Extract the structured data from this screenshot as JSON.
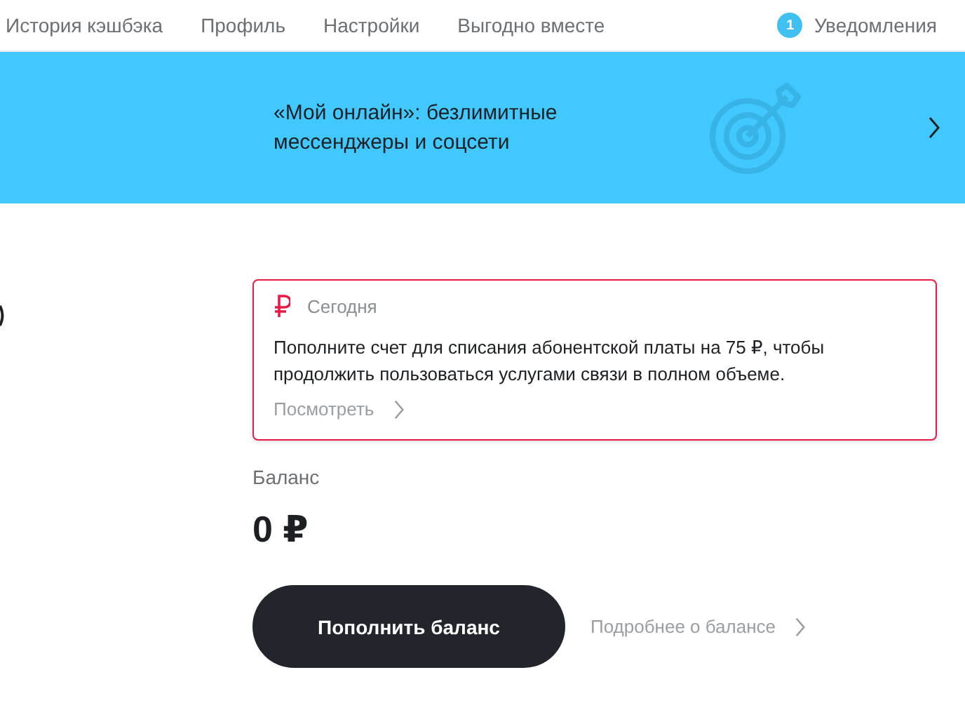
{
  "nav": {
    "items": [
      {
        "label": "История кэшбэка"
      },
      {
        "label": "Профиль"
      },
      {
        "label": "Настройки"
      },
      {
        "label": "Выгодно вместе"
      }
    ],
    "notifications": {
      "count": "1",
      "label": "Уведомления"
    }
  },
  "banner": {
    "text": "«Мой онлайн»: безлимитные мессенджеры и соцсети"
  },
  "alert": {
    "date": "Сегодня",
    "message": "Пополните счет для списания абонентской платы на 75 ₽, чтобы продолжить пользоваться услугами связи в полном объеме.",
    "link": "Посмотреть"
  },
  "balance": {
    "label": "Баланс",
    "amount": "0 ₽"
  },
  "actions": {
    "primary": "Пополнить баланс",
    "secondary": "Подробнее о балансе"
  }
}
